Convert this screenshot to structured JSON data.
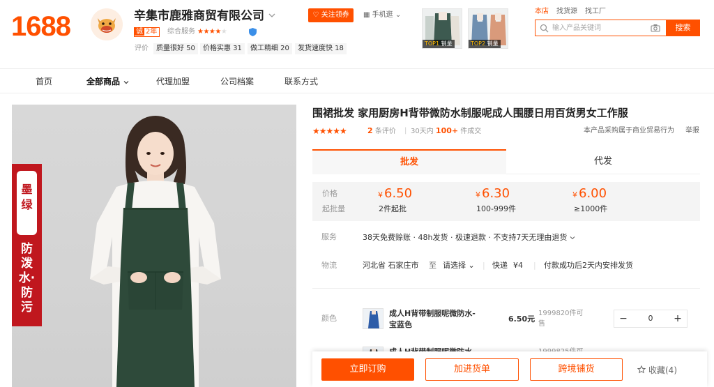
{
  "brand": {
    "logo_text": "1688",
    "accent": "#ff5000"
  },
  "shop": {
    "name": "辛集市鹿雅商贸有限公司",
    "years_tag": "诚",
    "years_label": "2年",
    "service_label": "综合服务",
    "service_stars": "★★★★",
    "service_stars_dim": "★",
    "eval_label": "评价",
    "tags": [
      "质量很好 50",
      "价格实惠 31",
      "做工精细 20",
      "发货速度快 18"
    ]
  },
  "header_actions": {
    "follow": "关注领券",
    "mobile": "手机逛"
  },
  "top_products": [
    {
      "rank": "TOP1",
      "label": "销量"
    },
    {
      "rank": "TOP2",
      "label": "销量"
    }
  ],
  "search": {
    "scopes": [
      "本店",
      "找货源",
      "找工厂"
    ],
    "placeholder": "输入产品关键词",
    "button": "搜索"
  },
  "nav": {
    "items": [
      "首页",
      "全部商品",
      "代理加盟",
      "公司档案",
      "联系方式"
    ]
  },
  "gallery": {
    "color_name": "墨绿",
    "feature": "防泼水·防污",
    "colors": {
      "banner": "#c0171e",
      "apron": "#2e4a3a"
    }
  },
  "product": {
    "title": "围裙批发 家用厨房H背带微防水制服呢成人围腰日用百货男女工作服",
    "stars": "★★★★★",
    "review_count": "2",
    "review_suffix": "条评价",
    "sales_prefix": "30天内",
    "sales_count": "100+",
    "sales_suffix": "件成交",
    "notice": "本产品采购属于商业贸易行为",
    "report": "举报"
  },
  "tabs": [
    "批发",
    "代发"
  ],
  "pricing": {
    "price_label": "价格",
    "moq_label": "起批量",
    "currency": "¥",
    "tiers": [
      {
        "price": "6.50",
        "qty": "2件起批"
      },
      {
        "price": "6.30",
        "qty": "100-999件"
      },
      {
        "price": "6.00",
        "qty": "≥1000件"
      }
    ]
  },
  "service": {
    "label": "服务",
    "text": "38天免费赊账 · 48h发货 · 极速退款 · 不支持7天无理由退货"
  },
  "logistics": {
    "label": "物流",
    "origin": "河北省 石家庄市",
    "to": "至",
    "destination": "请选择",
    "method": "快递",
    "fee": "¥4",
    "note": "付款成功后2天内安排发货"
  },
  "sku": {
    "label": "颜色",
    "items": [
      {
        "name": "成人H背带制服呢微防水-宝蓝色",
        "price": "6.50元",
        "stock": "1999820件可售",
        "qty": "0"
      },
      {
        "name": "成人H背带制服呢微防水-",
        "price": "",
        "stock": "1999825件可",
        "qty": ""
      }
    ]
  },
  "actions": {
    "buy": "立即订购",
    "cart": "加进货单",
    "crossborder": "跨境铺货",
    "fav": "收藏(4)"
  }
}
